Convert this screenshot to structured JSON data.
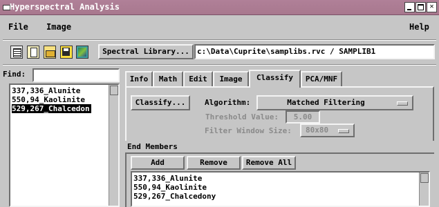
{
  "window": {
    "title": "Hyperspectral Analysis"
  },
  "menus": {
    "file": "File",
    "image": "Image",
    "help": "Help"
  },
  "toolbar": {
    "spectral_library_button": "Spectral Library...",
    "library_path": "c:\\Data\\Cuprite\\samplibs.rvc / SAMPLIB1"
  },
  "find": {
    "label": "Find:",
    "value": ""
  },
  "spectra_list": [
    "337,336_Alunite",
    "550,94_Kaolinite",
    "529,267_Chalcedon"
  ],
  "tabs": [
    "Info",
    "Math",
    "Edit",
    "Image",
    "Classify",
    "PCA/MNF"
  ],
  "active_tab": "Classify",
  "classify": {
    "button": "Classify...",
    "algorithm_label": "Algorithm:",
    "algorithm_value": "Matched Filtering",
    "threshold_label": "Threshold Value:",
    "threshold_value": "5.00",
    "filter_label": "Filter Window Size:",
    "filter_value": "80x80"
  },
  "end_members": {
    "title": "End Members",
    "add": "Add",
    "remove": "Remove",
    "remove_all": "Remove All",
    "items": [
      "337,336_Alunite",
      "550,94_Kaolinite",
      "529,267_Chalcedony"
    ]
  }
}
